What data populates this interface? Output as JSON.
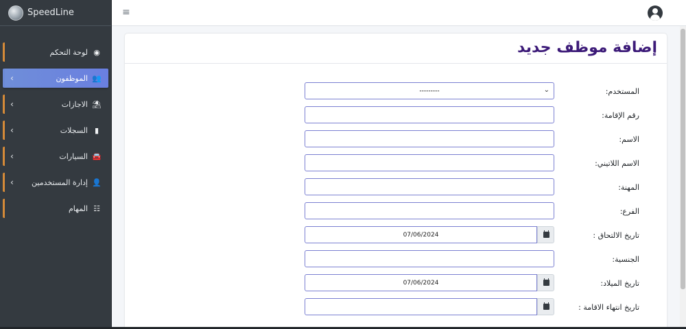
{
  "brand": {
    "name": "SpeedLine"
  },
  "sidebar": {
    "items": [
      {
        "label": "لوحة التحكم",
        "icon": "dashboard-icon",
        "glyph": "◉",
        "chevron": ""
      },
      {
        "label": "الموظفون",
        "icon": "users-icon",
        "glyph": "👥",
        "chevron": "‹"
      },
      {
        "label": "الاجازات",
        "icon": "umbrella-beach-icon",
        "glyph": "⛱",
        "chevron": "‹"
      },
      {
        "label": "السجلات",
        "icon": "file-icon",
        "glyph": "▮",
        "chevron": "‹"
      },
      {
        "label": "السيارات",
        "icon": "car-icon",
        "glyph": "🚘",
        "chevron": "‹"
      },
      {
        "label": "إدارة المستخدمين",
        "icon": "user-cog-icon",
        "glyph": "👤",
        "chevron": "‹"
      },
      {
        "label": "المهام",
        "icon": "tasks-icon",
        "glyph": "☷",
        "chevron": ""
      }
    ]
  },
  "topbar": {
    "menu_glyph": "≡"
  },
  "page": {
    "title": "إضافة موظف جديد"
  },
  "form": {
    "fields": [
      {
        "label": "المستخدم:",
        "type": "select",
        "value": "---------"
      },
      {
        "label": "رقم الإقامة:",
        "type": "text",
        "value": ""
      },
      {
        "label": "الاسم:",
        "type": "text",
        "value": ""
      },
      {
        "label": "الاسم اللاتيني:",
        "type": "text",
        "value": ""
      },
      {
        "label": "المهنة:",
        "type": "text",
        "value": ""
      },
      {
        "label": "الفرع:",
        "type": "text",
        "value": ""
      },
      {
        "label": "تاريخ الالتحاق :",
        "type": "date",
        "value": "07/06/2024"
      },
      {
        "label": "الجنسية:",
        "type": "text",
        "value": ""
      },
      {
        "label": "تاريخ الميلاد:",
        "type": "date",
        "value": "07/06/2024"
      },
      {
        "label": "تاريخ انتهاء الاقامة :",
        "type": "date",
        "value": ""
      }
    ]
  },
  "colors": {
    "sidebar_bg": "#343a40",
    "active_item": "#6f8ed9",
    "accent_border": "#d58a38",
    "title": "#3c1a78",
    "input_border": "#7a7fd1"
  }
}
